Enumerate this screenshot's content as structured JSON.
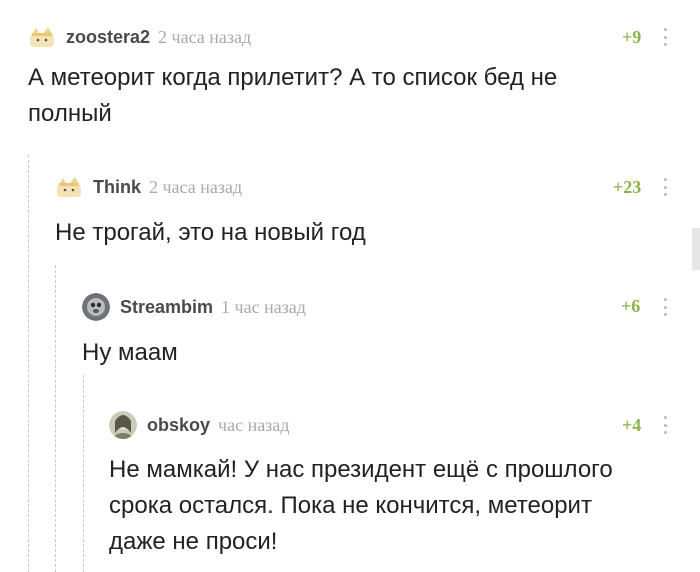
{
  "comments": [
    {
      "username": "zoostera2",
      "time": "2 часа назад",
      "rating": "+9",
      "text_lines": [
        "А метеорит когда прилетит? А то список бед не",
        "полный"
      ],
      "avatar_icon": "sushi-cat-avatar"
    },
    {
      "username": "Think",
      "time": "2 часа назад",
      "rating": "+23",
      "text_lines": [
        "Не трогай, это на новый год"
      ],
      "avatar_icon": "sushi-cat-avatar"
    },
    {
      "username": "Streambim",
      "time": "1 час назад",
      "rating": "+6",
      "text_lines": [
        "Ну маам"
      ],
      "avatar_icon": "animal-photo-avatar"
    },
    {
      "username": "obskoy",
      "time": "час назад",
      "rating": "+4",
      "text_lines": [
        "Не мамкай! У нас президент ещё с прошлого",
        "срока остался. Пока не кончится, метеорит",
        "даже не проси!"
      ],
      "avatar_icon": "portrait-avatar"
    }
  ],
  "colors": {
    "rating": "#8ab34a",
    "username": "#4a4a4a",
    "time": "#a9a9a9",
    "thread_line": "#c8c8c8"
  }
}
